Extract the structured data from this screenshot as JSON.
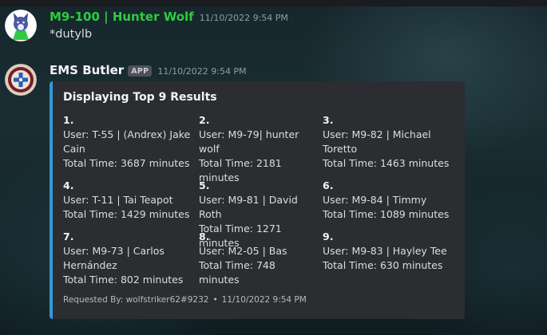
{
  "messages": [
    {
      "username": "M9-100 | Hunter Wolf",
      "username_color": "#2ecc40",
      "timestamp": "11/10/2022 9:54 PM",
      "text": "*dutylb",
      "avatar_icon": "wolf-avatar-icon"
    },
    {
      "username": "EMS Butler",
      "username_color": "#f2f3f5",
      "badge": "APP",
      "timestamp": "11/10/2022 9:54 PM",
      "avatar_icon": "ems-badge-avatar-icon",
      "embed": {
        "accent_color": "#3498db",
        "title": "Displaying Top 9 Results",
        "fields": [
          {
            "name": "1.",
            "user": "User: T-55 | (Andrex) Jake Cain",
            "time": "Total Time: 3687 minutes"
          },
          {
            "name": "2.",
            "user": "User: M9-79| hunter wolf",
            "time": "Total Time: 2181 minutes"
          },
          {
            "name": "3.",
            "user": "User: M9-82 | Michael Toretto",
            "time": "Total Time: 1463 minutes"
          },
          {
            "name": "4.",
            "user": "User: T-11 | Tai Teapot",
            "time": "Total Time: 1429 minutes"
          },
          {
            "name": "5.",
            "user": "User: M9-81 | David Roth",
            "time": "Total Time: 1271 minutes"
          },
          {
            "name": "6.",
            "user": "User: M9-84 | Timmy",
            "time": "Total Time: 1089 minutes"
          },
          {
            "name": "7.",
            "user": "User: M9-73 | Carlos Hernández",
            "time": "Total Time: 802 minutes"
          },
          {
            "name": "8.",
            "user": "User: M2-05 | Bas",
            "time": "Total Time: 748 minutes"
          },
          {
            "name": "9.",
            "user": "User: M9-83 | Hayley Tee",
            "time": "Total Time: 630 minutes"
          }
        ],
        "footer_text": "Requested By: wolfstriker62#9232",
        "footer_separator": "•",
        "footer_timestamp": "11/10/2022 9:54 PM"
      }
    }
  ]
}
